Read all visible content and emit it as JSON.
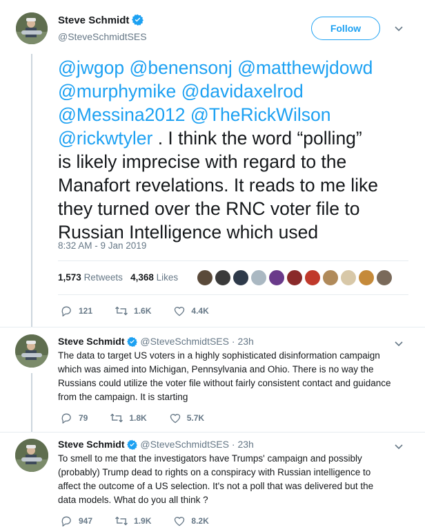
{
  "main_tweet": {
    "author_name": "Steve Schmidt",
    "author_handle": "@SteveSchmidtSES",
    "follow_label": "Follow",
    "mentions_line1": "@jwgop @benensonj @matthewjdowd",
    "mentions_line2": "@murphymike @davidaxelrod",
    "mentions_line3": "@Messina2012 @TheRickWilson",
    "mention_last": "@rickwtyler",
    "text_after_mention": " .  I think the word “polling”",
    "text_line5": "is likely imprecise with regard to the",
    "text_line6": "Manafort revelations. It reads to me like",
    "text_line7": "they turned over the RNC voter file to",
    "text_line8": "Russian Intelligence which used",
    "timestamp": "8:32 AM - 9 Jan 2019",
    "retweets_count": "1,573",
    "retweets_label": "Retweets",
    "likes_count": "4,368",
    "likes_label": "Likes",
    "reply_count": "121",
    "retweet_count": "1.6K",
    "like_count": "4.4K"
  },
  "replies": [
    {
      "author_name": "Steve Schmidt",
      "author_handle": "@SteveSchmidtSES",
      "time": "23h",
      "lines": [
        "The data to target US voters in a highly sophisticated disinformation campaign",
        "which was aimed into Michigan, Pennsylvania and Ohio. There is no way the",
        "Russians could utilize the voter file without fairly consistent contact and guidance",
        "from the campaign. It is starting"
      ],
      "reply_count": "79",
      "retweet_count": "1.8K",
      "like_count": "5.7K"
    },
    {
      "author_name": "Steve Schmidt",
      "author_handle": "@SteveSchmidtSES",
      "time": "23h",
      "lines": [
        "To smell to me that the investigators have Trumps' campaign and possibly",
        "(probably) Trump dead to rights on a conspiracy with Russian intelligence to",
        "affect the outcome of a US selection. It's not a poll that was delivered but the",
        "data models. What do you all think ?"
      ],
      "reply_count": "947",
      "retweet_count": "1.9K",
      "like_count": "8.2K"
    }
  ],
  "icons": {
    "verified": "verified-badge-icon",
    "reply": "reply-icon",
    "retweet": "retweet-icon",
    "like": "heart-icon",
    "more": "chevron-down-icon"
  },
  "colors": {
    "accent": "#1da1f2",
    "muted": "#657786",
    "text": "#14171a",
    "divider": "#e6ecf0"
  }
}
